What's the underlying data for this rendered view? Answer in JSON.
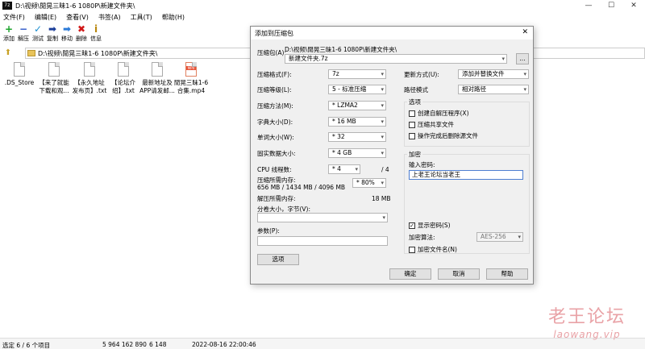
{
  "window": {
    "app_icon": "7z",
    "title": "D:\\视频\\閒晃三昧1-6  1080P\\新建文件夹\\",
    "controls": [
      "—",
      "☐",
      "✕"
    ]
  },
  "menu": [
    "文件(F)",
    "编辑(E)",
    "查看(V)",
    "书签(A)",
    "工具(T)",
    "帮助(H)"
  ],
  "toolbar": [
    {
      "label": "添加",
      "icon": "add-icon",
      "glyph": "+",
      "color": "#1aa32a"
    },
    {
      "label": "解压",
      "icon": "extract-icon",
      "glyph": "−",
      "color": "#2b55c8"
    },
    {
      "label": "测试",
      "icon": "test-icon",
      "glyph": "✓",
      "color": "#1b8fd0"
    },
    {
      "label": "复制",
      "icon": "copy-icon",
      "glyph": "➡",
      "color": "#1c3f9a"
    },
    {
      "label": "移动",
      "icon": "move-icon",
      "glyph": "➡",
      "color": "#2b7ad8"
    },
    {
      "label": "删除",
      "icon": "delete-icon",
      "glyph": "✖",
      "color": "#d01818"
    },
    {
      "label": "信息",
      "icon": "info-icon",
      "glyph": "i",
      "color": "#b8860b"
    }
  ],
  "address": {
    "path": "D:\\视频\\閒晃三昧1-6  1080P\\新建文件夹\\"
  },
  "files": [
    {
      "name": ".DS_Store",
      "line2": "",
      "type": "file"
    },
    {
      "name": "【来了就能",
      "line2": "下载和观...",
      "type": "file"
    },
    {
      "name": "【永久地址",
      "line2": "发布页】.txt",
      "type": "file"
    },
    {
      "name": "【论坛介",
      "line2": "绍】.txt",
      "type": "file"
    },
    {
      "name": "最新地址及",
      "line2": "APP请发邮...",
      "type": "file"
    },
    {
      "name": "閒晃三昧1-6",
      "line2": "合集.mp4",
      "type": "mp4",
      "badge": "MP4"
    }
  ],
  "status": {
    "selection": "选定 6 / 6 个项目",
    "size": "5 964 162 890",
    "packed": "6 148",
    "date": "2022-08-16 22:00:46"
  },
  "dialog": {
    "title": "添加到压缩包",
    "close": "✕",
    "archive_label": "压缩包(A):",
    "archive_path": "D:\\视频\\閒晃三昧1-6  1080P\\新建文件夹\\",
    "archive_name": "新建文件夹.7z",
    "browse": "...",
    "format_label": "压缩格式(F):",
    "format_value": "7z",
    "level_label": "压缩等级(L):",
    "level_value": "5 - 标准压缩",
    "method_label": "压缩方法(M):",
    "method_value": "* LZMA2",
    "dict_label": "字典大小(D):",
    "dict_value": "* 16 MB",
    "word_label": "单词大小(W):",
    "word_value": "* 32",
    "solid_label": "固实数据大小:",
    "solid_value": "* 4 GB",
    "cpu_label": "CPU 线程数:",
    "cpu_value": "* 4",
    "cpu_total": "/ 4",
    "mem_label": "压缩所需内存:",
    "mem_detail": "656 MB / 1434 MB / 4096 MB",
    "mem_value": "* 80%",
    "decomp_label": "解压所需内存:",
    "decomp_value": "18 MB",
    "split_label": "分卷大小，字节(V):",
    "split_value": "",
    "params_label": "参数(P):",
    "params_value": "",
    "options_button": "选项",
    "update_label": "更新方式(U):",
    "update_value": "添加并替换文件",
    "path_label": "路径模式",
    "path_value": "相对路径",
    "options_group": "选项",
    "opt_sfx": "创建自解压程序(X)",
    "opt_shared": "压缩共享文件",
    "opt_delete": "操作完成后删除源文件",
    "encrypt_group": "加密",
    "password_label": "输入密码:",
    "password_value": "上老王论坛当老王",
    "show_password": "显示密码(S)",
    "enc_method_label": "加密算法:",
    "enc_method_value": "AES-256",
    "encrypt_names": "加密文件名(N)",
    "ok": "确定",
    "cancel": "取消",
    "help": "帮助"
  },
  "watermark": {
    "line1": "老王论坛",
    "line2": "laowang.vip"
  }
}
